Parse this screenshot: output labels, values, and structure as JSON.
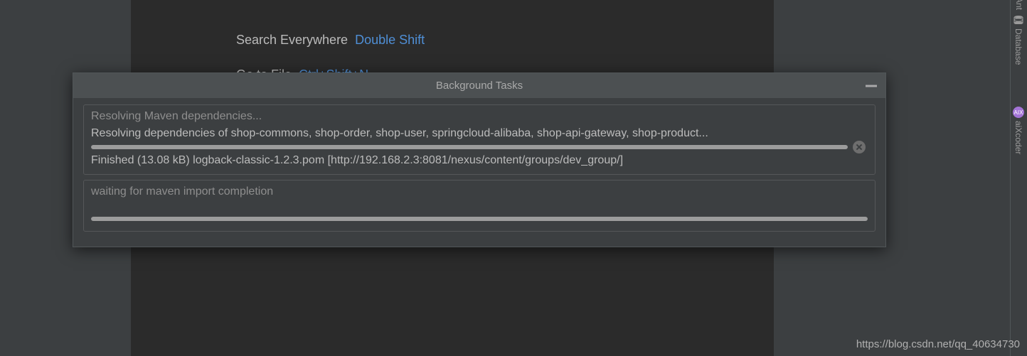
{
  "shortcuts": {
    "search_label": "Search Everywhere",
    "search_key": "Double Shift",
    "goto_label": "Go to File",
    "goto_key": "Ctrl+Shift+N"
  },
  "dialog": {
    "title": "Background Tasks",
    "task1": {
      "title": "Resolving Maven dependencies...",
      "detail": "Resolving dependencies of shop-commons, shop-order, shop-user, springcloud-alibaba, shop-api-gateway, shop-product...",
      "status": "Finished (13.08 kB) logback-classic-1.2.3.pom [http://192.168.2.3:8081/nexus/content/groups/dev_group/]",
      "progress": 100
    },
    "task2": {
      "title": "waiting for maven import completion",
      "progress": 100
    }
  },
  "rail": {
    "ant": "Ant",
    "database": "Database",
    "aixcoder": "aiXcoder",
    "aix_icon_text": "AIX"
  },
  "watermark": "https://blog.csdn.net/qq_40634730"
}
